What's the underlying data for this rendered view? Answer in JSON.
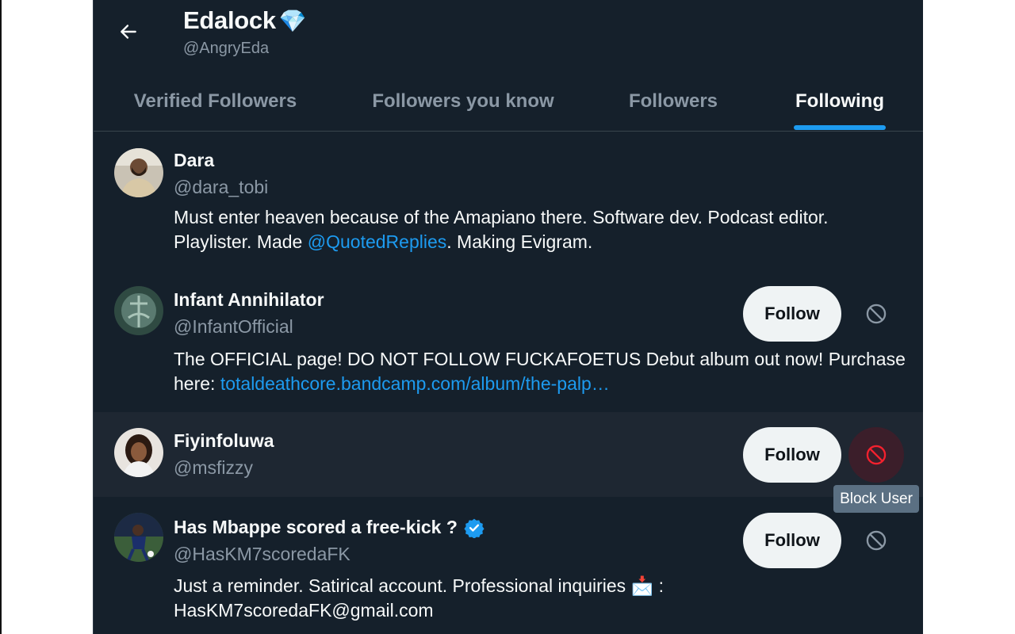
{
  "header": {
    "back_label": "Back",
    "display_name": "Edalock",
    "emoji": "💎",
    "handle": "@AngryEda"
  },
  "tabs": [
    {
      "label": "Verified Followers",
      "active": false
    },
    {
      "label": "Followers you know",
      "active": false
    },
    {
      "label": "Followers",
      "active": false
    },
    {
      "label": "Following",
      "active": true
    }
  ],
  "users": [
    {
      "name": "Dara",
      "handle": "@dara_tobi",
      "bio_text_1": "Must enter heaven because of the Amapiano there. Software dev. Podcast editor. Playlister. Made ",
      "bio_link": "@QuotedReplies",
      "bio_text_2": ". Making Evigram.",
      "follow_label": "",
      "verified": false
    },
    {
      "name": "Infant Annihilator",
      "handle": "@InfantOfficial",
      "bio_text_1": "The OFFICIAL page! DO NOT FOLLOW FUCKAFOETUS Debut album out now! Purchase here: ",
      "bio_link": "totaldeathcore.bandcamp.com/album/the-palp…",
      "follow_label": "Follow",
      "verified": false
    },
    {
      "name": "Fiyinfoluwa",
      "handle": "@msfizzy",
      "follow_label": "Follow",
      "verified": false
    },
    {
      "name": "Has Mbappe scored a free-kick ?",
      "handle": "@HasKM7scoredaFK",
      "bio_text_1": "Just a reminder. Satirical account. Professional inquiries ",
      "bio_emoji": "📩",
      "bio_text_2": " : HasKM7scoredaFK@gmail.com",
      "follow_label": "Follow",
      "verified": true
    }
  ],
  "tooltip": "Block User",
  "colors": {
    "background": "#15202b",
    "hover_row": "#1e2732",
    "accent": "#1d9bf0",
    "muted_text": "#8b98a5",
    "block_hot": "#f4212e"
  }
}
